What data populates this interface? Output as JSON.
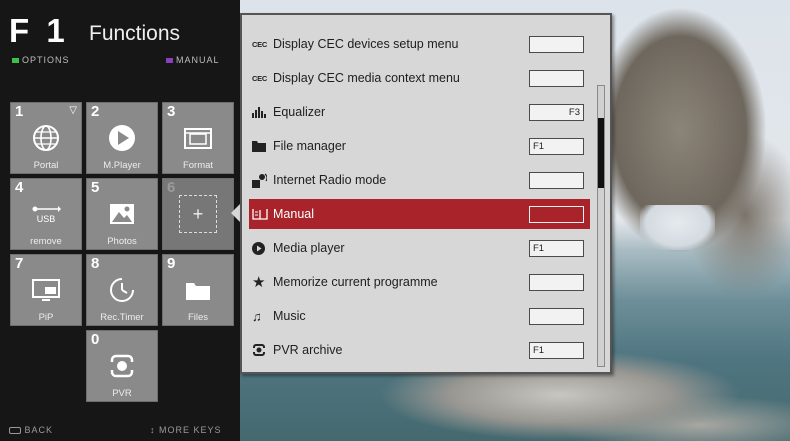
{
  "f1_panel": {
    "key": "F 1",
    "title": "Functions",
    "legend_options": "Options",
    "legend_manual": "Manual",
    "options_color": "#3dbf4a",
    "manual_color": "#8a3fbf"
  },
  "tiles": [
    {
      "num": "1",
      "label": "Portal",
      "icon": "globe-icon"
    },
    {
      "num": "2",
      "label": "M.Player",
      "icon": "play-icon"
    },
    {
      "num": "3",
      "label": "Format",
      "icon": "format-icon"
    },
    {
      "num": "4",
      "label": "remove",
      "icon": "usb-icon",
      "icon_text": "USB"
    },
    {
      "num": "5",
      "label": "Photos",
      "icon": "photo-icon"
    },
    {
      "num": "6",
      "label": "",
      "icon": "add-icon"
    },
    {
      "num": "7",
      "label": "PiP",
      "icon": "pip-icon"
    },
    {
      "num": "8",
      "label": "Rec.Timer",
      "icon": "timer-icon"
    },
    {
      "num": "9",
      "label": "Files",
      "icon": "folder-icon"
    },
    {
      "num": "0",
      "label": "PVR",
      "icon": "pvr-icon"
    }
  ],
  "footer": {
    "back": "Back",
    "more": "More keys"
  },
  "menu": {
    "items": [
      {
        "label": "Display CEC devices setup menu",
        "icon": "cec-icon",
        "icon_text": "CEC",
        "key": ""
      },
      {
        "label": "Display CEC media context menu",
        "icon": "cec-icon",
        "icon_text": "CEC",
        "key": ""
      },
      {
        "label": "Equalizer",
        "icon": "equalizer-icon",
        "key": "F3"
      },
      {
        "label": "File manager",
        "icon": "folder-icon",
        "key": "F1"
      },
      {
        "label": "Internet Radio mode",
        "icon": "radio-icon",
        "key": ""
      },
      {
        "label": "Manual",
        "icon": "manual-icon",
        "key": "",
        "selected": true
      },
      {
        "label": "Media player",
        "icon": "play-icon",
        "key": "F1"
      },
      {
        "label": "Memorize current programme",
        "icon": "star-icon",
        "key": ""
      },
      {
        "label": "Music",
        "icon": "music-icon",
        "key": ""
      },
      {
        "label": "PVR archive",
        "icon": "pvr-icon",
        "key": "F1"
      }
    ],
    "scroll_position": 0.15
  },
  "colors": {
    "selected": "#a8232a",
    "panel": "#161616",
    "tile": "#8a8a8a",
    "menu_bg": "#d7d7d7"
  }
}
